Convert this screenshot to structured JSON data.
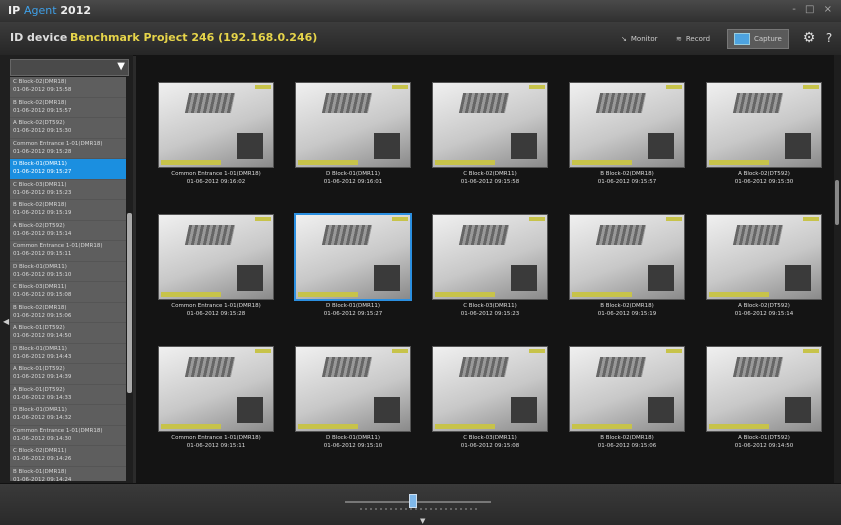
{
  "window": {
    "title_ip": "IP",
    "title_agent": "Agent",
    "title_year": "2012",
    "controls": "- □ ×"
  },
  "header": {
    "id_label": "ID device",
    "project": "Benchmark Project 246 (192.168.0.246)",
    "monitor": "Monitor",
    "record": "Record",
    "capture": "Capture"
  },
  "sidebar": {
    "items": [
      {
        "name": "C Block-02(DMR18)",
        "time": "01-06-2012 09:15:58"
      },
      {
        "name": "B Block-02(DMR18)",
        "time": "01-06-2012 09:15:57"
      },
      {
        "name": "A Block-02(DT592)",
        "time": "01-06-2012 09:15:30"
      },
      {
        "name": "Common Entrance 1-01(DMR18)",
        "time": "01-06-2012 09:15:28"
      },
      {
        "name": "D Block-01(DMR11)",
        "time": "01-06-2012 09:15:27"
      },
      {
        "name": "C Block-03(DMR11)",
        "time": "01-06-2012 09:15:23"
      },
      {
        "name": "B Block-02(DMR18)",
        "time": "01-06-2012 09:15:19"
      },
      {
        "name": "A Block-02(DT592)",
        "time": "01-06-2012 09:15:14"
      },
      {
        "name": "Common Entrance 1-01(DMR18)",
        "time": "01-06-2012 09:15:11"
      },
      {
        "name": "D Block-01(DMR11)",
        "time": "01-06-2012 09:15:10"
      },
      {
        "name": "C Block-03(DMR11)",
        "time": "01-06-2012 09:15:08"
      },
      {
        "name": "B Block-02(DMR18)",
        "time": "01-06-2012 09:15:06"
      },
      {
        "name": "A Block-01(DT592)",
        "time": "01-06-2012 09:14:50"
      },
      {
        "name": "D Block-01(DMR11)",
        "time": "01-06-2012 09:14:43"
      },
      {
        "name": "A Block-01(DT592)",
        "time": "01-06-2012 09:14:39"
      },
      {
        "name": "A Block-01(DT592)",
        "time": "01-06-2012 09:14:33"
      },
      {
        "name": "D Block-01(DMR11)",
        "time": "01-06-2012 09:14:32"
      },
      {
        "name": "Common Entrance 1-01(DMR18)",
        "time": "01-06-2012 09:14:30"
      },
      {
        "name": "C Block-02(DMR11)",
        "time": "01-06-2012 09:14:26"
      },
      {
        "name": "B Block-01(DMR18)",
        "time": "01-06-2012 09:14:24"
      }
    ],
    "selected_index": 4
  },
  "captures": [
    {
      "name": "Common Entrance 1-01(DMR18)",
      "time": "01-06-2012 09:16:02"
    },
    {
      "name": "D Block-01(DMR11)",
      "time": "01-06-2012 09:16:01"
    },
    {
      "name": "C Block-02(DMR11)",
      "time": "01-06-2012 09:15:58"
    },
    {
      "name": "B Block-02(DMR18)",
      "time": "01-06-2012 09:15:57"
    },
    {
      "name": "A Block-02(DT592)",
      "time": "01-06-2012 09:15:30"
    },
    {
      "name": "Common Entrance 1-01(DMR18)",
      "time": "01-06-2012 09:15:28"
    },
    {
      "name": "D Block-01(DMR11)",
      "time": "01-06-2012 09:15:27"
    },
    {
      "name": "C Block-03(DMR11)",
      "time": "01-06-2012 09:15:23"
    },
    {
      "name": "B Block-02(DMR18)",
      "time": "01-06-2012 09:15:19"
    },
    {
      "name": "A Block-02(DT592)",
      "time": "01-06-2012 09:15:14"
    },
    {
      "name": "Common Entrance 1-01(DMR18)",
      "time": "01-06-2012 09:15:11"
    },
    {
      "name": "D Block-01(DMR11)",
      "time": "01-06-2012 09:15:10"
    },
    {
      "name": "C Block-03(DMR11)",
      "time": "01-06-2012 09:15:08"
    },
    {
      "name": "B Block-02(DMR18)",
      "time": "01-06-2012 09:15:06"
    },
    {
      "name": "A Block-01(DT592)",
      "time": "01-06-2012 09:14:50"
    }
  ],
  "selected_capture": 6,
  "icons": {
    "filter": "filter-icon",
    "monitor": "monitor-icon",
    "record": "record-icon",
    "capture": "camera-icon",
    "settings": "gear-icon",
    "help": "help-icon"
  },
  "colors": {
    "accent": "#1b8fe0",
    "project": "#e6d44a"
  }
}
